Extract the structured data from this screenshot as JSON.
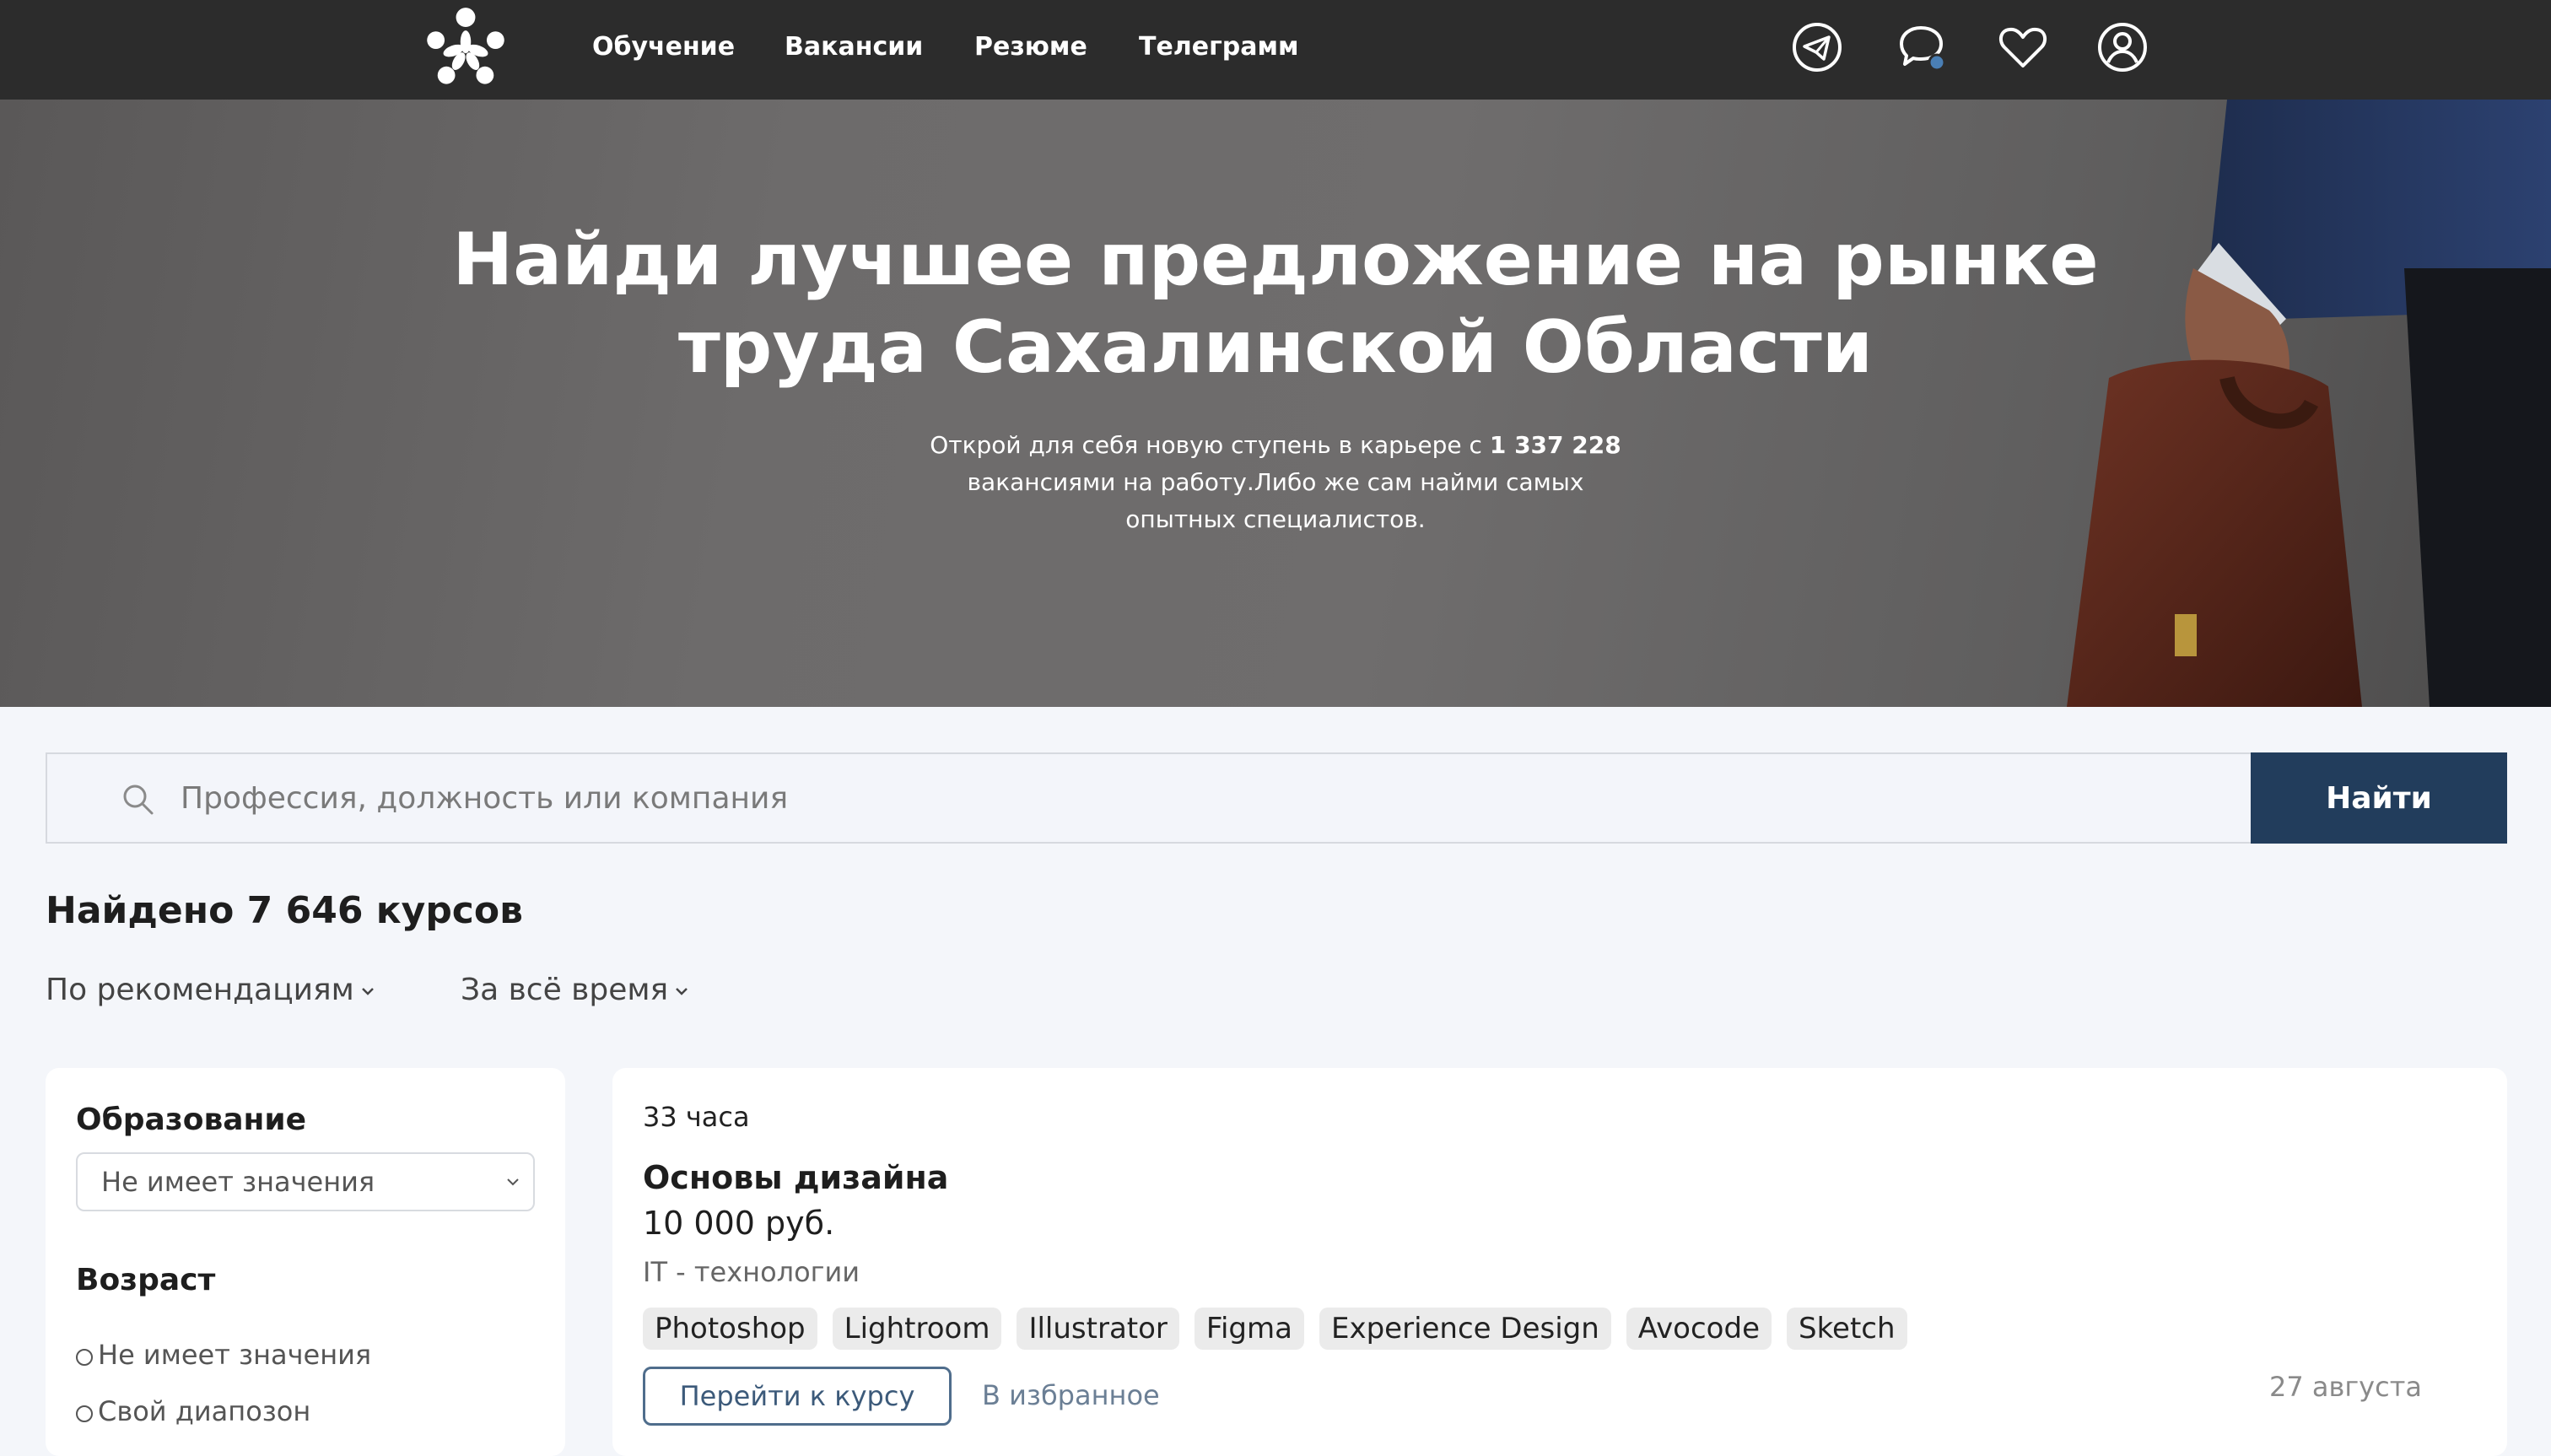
{
  "nav": {
    "links": [
      {
        "label": "Обучение"
      },
      {
        "label": "Вакансии"
      },
      {
        "label": "Резюме"
      },
      {
        "label": "Телеграмм"
      }
    ],
    "icons": [
      "telegram-icon",
      "chat-icon",
      "heart-icon",
      "user-icon"
    ],
    "notification_dot_color": "#4a7fb5"
  },
  "hero": {
    "title_line1": "Найди лучшее предложение на рынке",
    "title_line2": "труда Сахалинской Области",
    "subtitle_prefix": "Открой для себя новую ступень в карьере с ",
    "subtitle_count": "1 337 228",
    "subtitle_line2": "вакансиями на работу.Либо же сам найми самых",
    "subtitle_line3": "опытных специалистов."
  },
  "search": {
    "placeholder": "Профессия, должность или компания",
    "button_label": "Найти",
    "button_color": "#223d5c"
  },
  "results": {
    "count_label": "Найдено 7 646 курсов"
  },
  "sort": {
    "order": "По рекомендациям",
    "period": "За всё время"
  },
  "filters": {
    "education": {
      "title": "Образование",
      "selected": "Не имеет значения"
    },
    "age": {
      "title": "Возраст",
      "options": [
        "Не имеет значения",
        "Свой диапозон"
      ]
    }
  },
  "courses": [
    {
      "duration": "33 часа",
      "title": "Основы дизайна",
      "price": "10 000 руб.",
      "category": "IT - технологии",
      "tags": [
        "Photoshop",
        "Lightroom",
        "Illustrator",
        "Figma",
        "Experience Design",
        "Avocode",
        "Sketch"
      ],
      "goto_label": "Перейти к курсу",
      "favorite_label": "В избранное",
      "date": "27 августа"
    }
  ]
}
